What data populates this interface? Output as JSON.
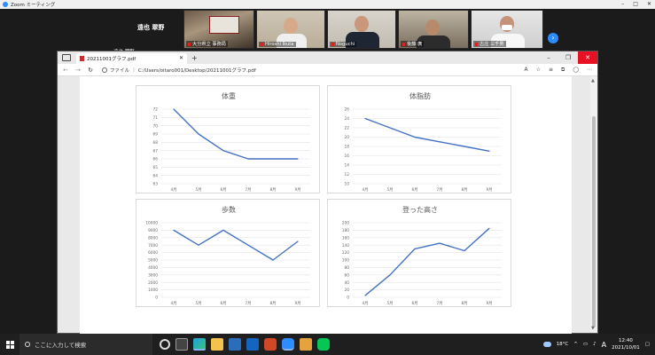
{
  "zoom": {
    "window_title": "Zoom ミーティング",
    "active_speaker": "遠也 翠野",
    "self_view_name": "遠也 翠野",
    "participants": [
      {
        "name": "大分県立 事務局"
      },
      {
        "name": "Hiroshi Ikuta"
      },
      {
        "name": "Noguchi"
      },
      {
        "name": "後藤 廣"
      },
      {
        "name": "古庄 三千男"
      }
    ]
  },
  "browser": {
    "tab_title": "20211001グラフ.pdf",
    "address_label": "ファイル",
    "url": "C:/Users/oitaro001/Desktop/20211001グラフ.pdf"
  },
  "charts": [
    {
      "id": "weight",
      "type": "line",
      "title": "体重",
      "categories": [
        "4月",
        "5月",
        "6月",
        "7月",
        "8月",
        "9月"
      ],
      "values": [
        72,
        69,
        67,
        66,
        66,
        66
      ],
      "ylim": [
        63,
        72
      ],
      "ystep": 1,
      "color": "#4472c4"
    },
    {
      "id": "bodyfat",
      "type": "line",
      "title": "体脂肪",
      "categories": [
        "4月",
        "5月",
        "6月",
        "7月",
        "8月",
        "9月"
      ],
      "values": [
        24,
        22,
        20,
        19,
        18,
        17
      ],
      "ylim": [
        10,
        26
      ],
      "ystep": 2,
      "color": "#4472c4"
    },
    {
      "id": "steps",
      "type": "line",
      "title": "歩数",
      "categories": [
        "4月",
        "5月",
        "6月",
        "7月",
        "8月",
        "9月"
      ],
      "values": [
        9000,
        7000,
        9000,
        7000,
        5000,
        7500
      ],
      "ylim": [
        0,
        10000
      ],
      "ystep": 1000,
      "color": "#4472c4"
    },
    {
      "id": "climbed",
      "type": "line",
      "title": "登った高さ",
      "categories": [
        "4月",
        "5月",
        "6月",
        "7月",
        "8月",
        "9月"
      ],
      "values": [
        5,
        60,
        130,
        145,
        125,
        185
      ],
      "ylim": [
        0,
        200
      ],
      "ystep": 20,
      "color": "#4472c4"
    }
  ],
  "taskbar": {
    "search_placeholder": "ここに入力して検索",
    "temperature": "18°C",
    "ime": "A",
    "time": "12:40",
    "date": "2021/10/01"
  },
  "colors": {
    "accent": "#2d8cff",
    "close": "#e81123",
    "series": "#4472c4"
  }
}
